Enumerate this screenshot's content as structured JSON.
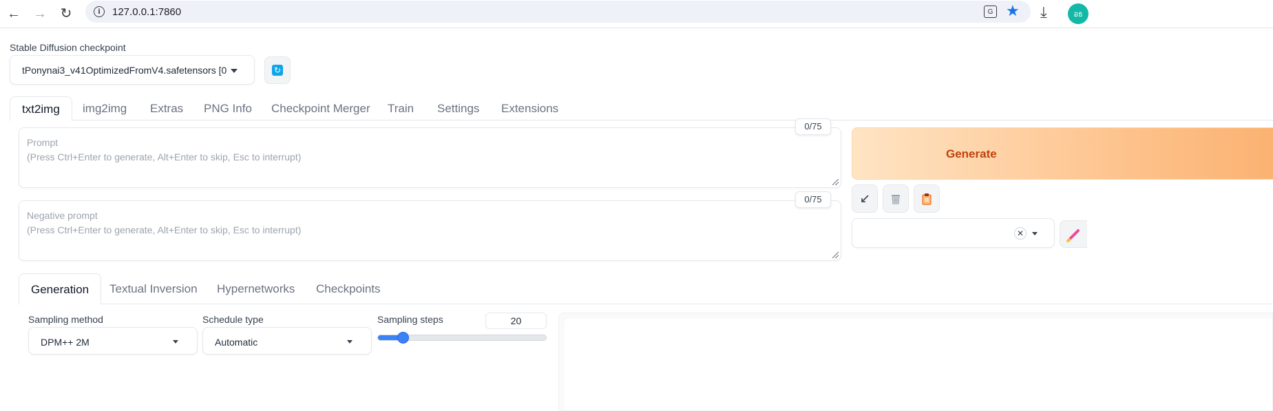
{
  "browser": {
    "url": "127.0.0.1:7860",
    "profile_initials": "อธ"
  },
  "checkpoint": {
    "label": "Stable Diffusion checkpoint",
    "value": "tPonynai3_v41OptimizedFromV4.safetensors [0"
  },
  "main_tabs": [
    {
      "label": "txt2img",
      "selected": true
    },
    {
      "label": "img2img"
    },
    {
      "label": "Extras"
    },
    {
      "label": "PNG Info"
    },
    {
      "label": "Checkpoint Merger"
    },
    {
      "label": "Train"
    },
    {
      "label": "Settings"
    },
    {
      "label": "Extensions"
    }
  ],
  "prompt": {
    "placeholder_title": "Prompt",
    "placeholder_hint": "(Press Ctrl+Enter to generate, Alt+Enter to skip, Esc to interrupt)",
    "token_count": "0/75"
  },
  "negative_prompt": {
    "placeholder_title": "Negative prompt",
    "placeholder_hint": "(Press Ctrl+Enter to generate, Alt+Enter to skip, Esc to interrupt)",
    "token_count": "0/75"
  },
  "generate": {
    "label": "Generate"
  },
  "sub_tabs": [
    {
      "label": "Generation",
      "selected": true
    },
    {
      "label": "Textual Inversion"
    },
    {
      "label": "Hypernetworks"
    },
    {
      "label": "Checkpoints"
    }
  ],
  "sampling_method": {
    "label": "Sampling method",
    "value": "DPM++ 2M"
  },
  "schedule_type": {
    "label": "Schedule type",
    "value": "Automatic"
  },
  "sampling_steps": {
    "label": "Sampling steps",
    "value": "20",
    "min": 1,
    "max": 150,
    "current": 20
  },
  "colors": {
    "accent": "#3b82f6",
    "generate_text": "#c2410c",
    "generate_bg_start": "#ffe4c4",
    "generate_bg_end": "#fbb272"
  }
}
